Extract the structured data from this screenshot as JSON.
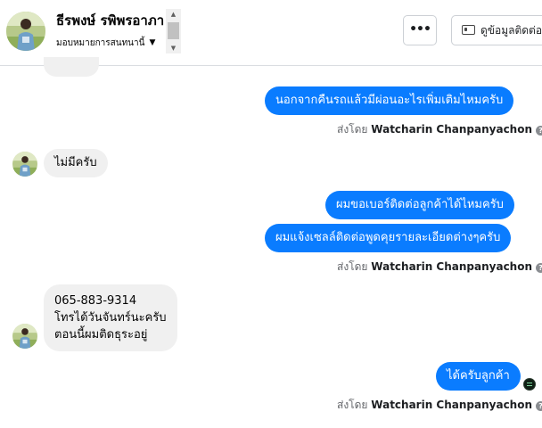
{
  "header": {
    "name": "ธีรพงษ์ รพิพรอาภา",
    "subtitle": "มอบหมายการสนทนานี้",
    "more_label": "•••",
    "contact_button_label": "ดูข้อมูลติดต่อ"
  },
  "messages": [
    {
      "direction": "outgoing",
      "text": "นอกจากคืนรถแล้วมีผ่อนอะไรเพิ่มเติมไหมครับ"
    },
    {
      "direction": "incoming",
      "text": "ไม่มีครับ"
    },
    {
      "direction": "outgoing",
      "text": "ผมขอเบอร์ติดต่อลูกค้าได้ไหมครับ"
    },
    {
      "direction": "outgoing",
      "text": "ผมแจ้งเซลล์ติดต่อพูดคุยรายละเอียดต่างๆครับ"
    },
    {
      "direction": "incoming",
      "lines": [
        "065-883-9314",
        "โทรได้วันจันทร์นะครับ",
        "ตอนนี้ผมติดธุระอยู่"
      ]
    },
    {
      "direction": "outgoing",
      "text": "ได้ครับลูกค้า"
    }
  ],
  "sent_by": {
    "prefix": "ส่งโดย",
    "agent": "Watcharin Chanpanyachon"
  },
  "icons": {
    "avatar": "profile-photo",
    "help": "question-mark-icon",
    "card": "contact-card-icon",
    "caret": "caret-down-icon"
  },
  "colors": {
    "outgoing_bubble": "#0a7cff",
    "incoming_bubble": "#f0f0f0",
    "meta_text": "#65676b"
  }
}
